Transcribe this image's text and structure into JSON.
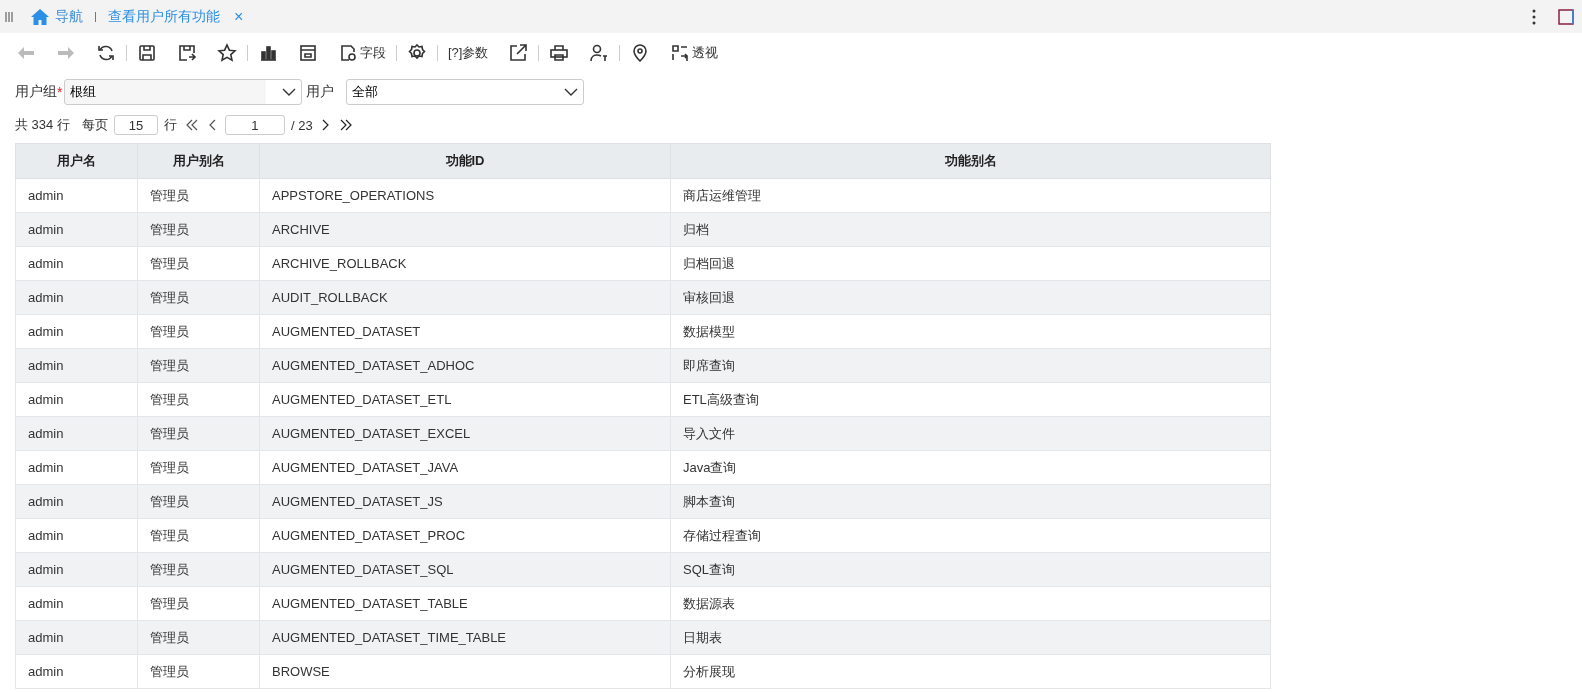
{
  "tabs": [
    {
      "label": "导航",
      "kind": "home",
      "selected": false
    },
    {
      "label": "查看用户所有功能",
      "kind": "page",
      "selected": true
    }
  ],
  "close_glyph": "×",
  "toolbar": [
    {
      "kind": "back",
      "disabled": true
    },
    {
      "kind": "forward",
      "disabled": true
    },
    {
      "kind": "refresh",
      "disabled": false
    },
    {
      "kind": "save",
      "disabled": false
    },
    {
      "kind": "save-as",
      "disabled": false
    },
    {
      "kind": "star",
      "disabled": false
    },
    {
      "kind": "chart",
      "disabled": false
    },
    {
      "kind": "layout",
      "disabled": false
    },
    {
      "kind": "fields",
      "label": "字段",
      "disabled": false
    },
    {
      "kind": "settings",
      "disabled": false
    },
    {
      "kind": "params",
      "label": "[?]参数",
      "disabled": false
    },
    {
      "kind": "export",
      "disabled": false
    },
    {
      "kind": "print",
      "disabled": false
    },
    {
      "kind": "user",
      "disabled": false
    },
    {
      "kind": "pin",
      "disabled": false
    },
    {
      "kind": "pivot",
      "label": "透视",
      "disabled": false
    }
  ],
  "filters": [
    {
      "label": "用户组",
      "required_mark": "*",
      "value": "根组"
    },
    {
      "label": "用户",
      "value": "全部"
    }
  ],
  "pagination": {
    "total": "共 334 行",
    "per_page_label": "每页",
    "per_page": "15",
    "per_page_unit": "行",
    "page": "1",
    "page_count": "/ 23"
  },
  "table": {
    "columns": [
      "用户名",
      "用户别名",
      "功能ID",
      "功能别名"
    ],
    "rows": [
      [
        "admin",
        "管理员",
        "APPSTORE_OPERATIONS",
        "商店运维管理"
      ],
      [
        "admin",
        "管理员",
        "ARCHIVE",
        "归档"
      ],
      [
        "admin",
        "管理员",
        "ARCHIVE_ROLLBACK",
        "归档回退"
      ],
      [
        "admin",
        "管理员",
        "AUDIT_ROLLBACK",
        "审核回退"
      ],
      [
        "admin",
        "管理员",
        "AUGMENTED_DATASET",
        "数据模型"
      ],
      [
        "admin",
        "管理员",
        "AUGMENTED_DATASET_ADHOC",
        "即席查询"
      ],
      [
        "admin",
        "管理员",
        "AUGMENTED_DATASET_ETL",
        "ETL高级查询"
      ],
      [
        "admin",
        "管理员",
        "AUGMENTED_DATASET_EXCEL",
        "导入文件"
      ],
      [
        "admin",
        "管理员",
        "AUGMENTED_DATASET_JAVA",
        "Java查询"
      ],
      [
        "admin",
        "管理员",
        "AUGMENTED_DATASET_JS",
        "脚本查询"
      ],
      [
        "admin",
        "管理员",
        "AUGMENTED_DATASET_PROC",
        "存储过程查询"
      ],
      [
        "admin",
        "管理员",
        "AUGMENTED_DATASET_SQL",
        "SQL查询"
      ],
      [
        "admin",
        "管理员",
        "AUGMENTED_DATASET_TABLE",
        "数据源表"
      ],
      [
        "admin",
        "管理员",
        "AUGMENTED_DATASET_TIME_TABLE",
        "日期表"
      ],
      [
        "admin",
        "管理员",
        "BROWSE",
        "分析展现"
      ]
    ]
  }
}
